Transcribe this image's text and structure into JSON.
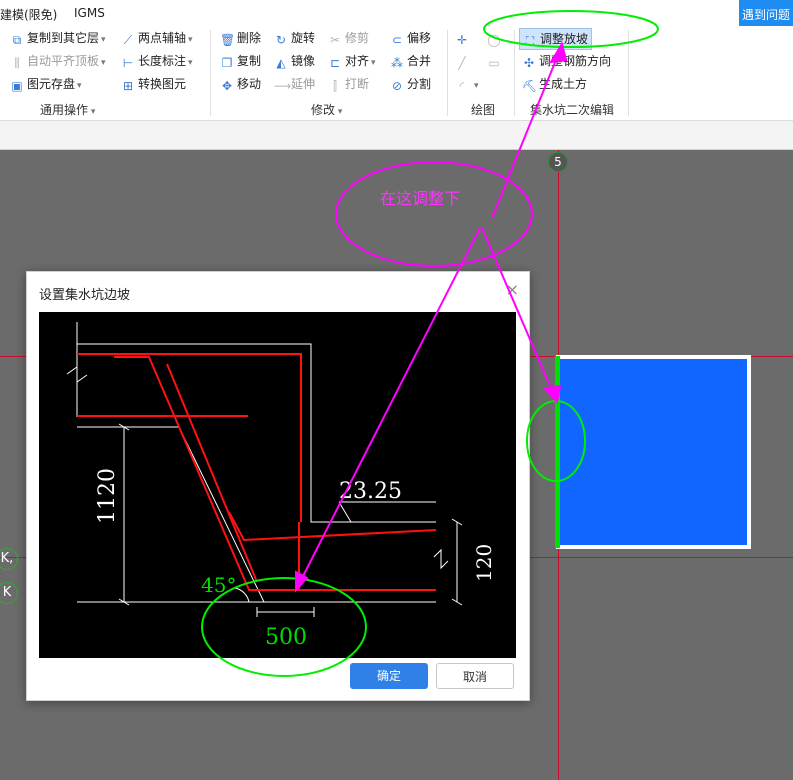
{
  "menu": {
    "items": [
      "建模(限免)",
      "IGMS"
    ],
    "help_button": "遇到问题"
  },
  "ribbon": {
    "general": {
      "copy_to_layer": "复制到其它层",
      "auto_flush_top": "自动平齐顶板",
      "save_element": "图元存盘",
      "two_point_axis": "两点辅轴",
      "length_dimension": "长度标注",
      "convert_element": "转换图元",
      "group_label": "通用操作"
    },
    "modify": {
      "delete": "删除",
      "rotate": "旋转",
      "trim": "修剪",
      "offset": "偏移",
      "copy": "复制",
      "mirror": "镜像",
      "align": "对齐",
      "merge": "合并",
      "move": "移动",
      "extend": "延伸",
      "break": "打断",
      "split": "分割",
      "group_label": "修改"
    },
    "draw": {
      "group_label": "绘图"
    },
    "sump": {
      "adjust_slope": "调整放坡",
      "adjust_rebar_direction": "调整钢筋方向",
      "generate_earthwork": "生成土方",
      "group_label": "集水坑二次编辑"
    }
  },
  "canvas": {
    "axis_number_top": "5",
    "side_labels": [
      "K,",
      "K"
    ],
    "annotation_text": "在这调整下",
    "colors": {
      "pit_fill": "#1166ff",
      "pit_edge": "#00e000",
      "annotation_magenta": "#ff00ff",
      "annotation_green": "#00ee00"
    }
  },
  "dialog": {
    "title": "设置集水坑边坡",
    "close": "×",
    "ok_label": "确定",
    "cancel_label": "取消",
    "drawing": {
      "dim_depth": "1120",
      "dim_angle_value": "23.25",
      "dim_thickness": "120",
      "slope_angle": "45°",
      "slope_width": "500"
    }
  }
}
